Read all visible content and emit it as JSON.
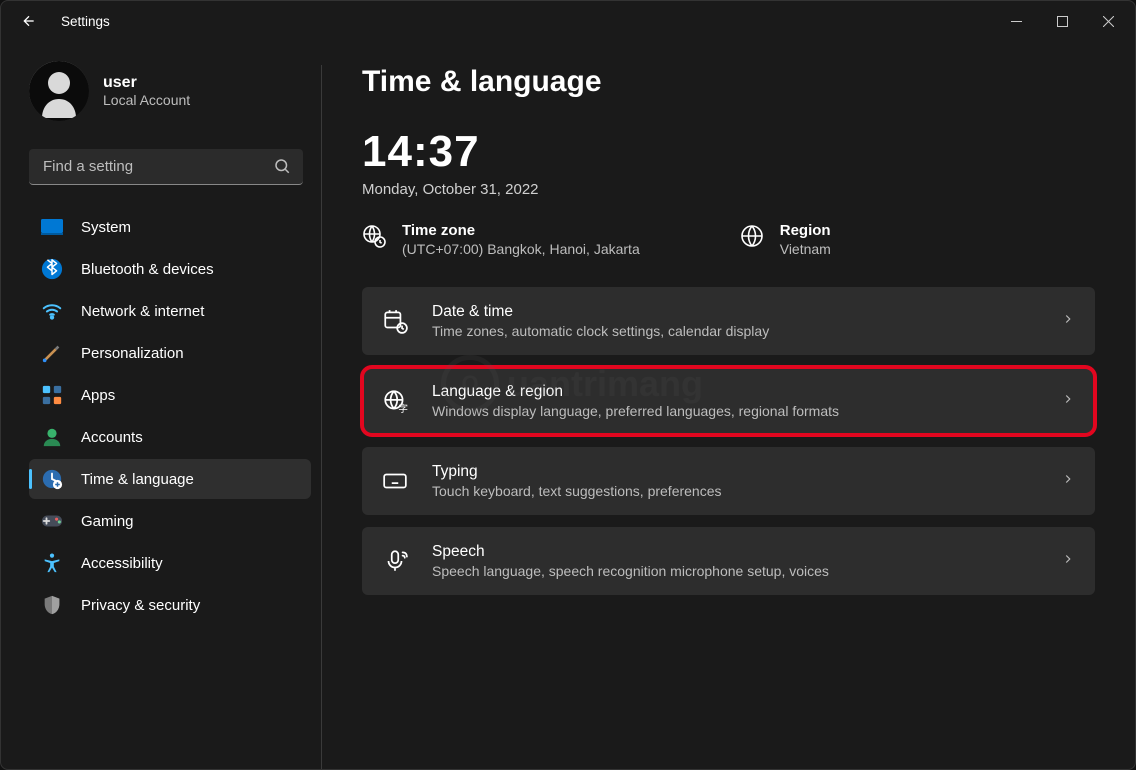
{
  "window": {
    "title": "Settings"
  },
  "user": {
    "name": "user",
    "subtitle": "Local Account"
  },
  "search": {
    "placeholder": "Find a setting"
  },
  "nav": {
    "items": [
      {
        "icon": "system",
        "label": "System"
      },
      {
        "icon": "bluetooth",
        "label": "Bluetooth & devices"
      },
      {
        "icon": "wifi",
        "label": "Network & internet"
      },
      {
        "icon": "personalize",
        "label": "Personalization"
      },
      {
        "icon": "apps",
        "label": "Apps"
      },
      {
        "icon": "accounts",
        "label": "Accounts"
      },
      {
        "icon": "timelang",
        "label": "Time & language"
      },
      {
        "icon": "gaming",
        "label": "Gaming"
      },
      {
        "icon": "accessibility",
        "label": "Accessibility"
      },
      {
        "icon": "privacy",
        "label": "Privacy & security"
      }
    ],
    "active_index": 6
  },
  "page": {
    "title": "Time & language",
    "time": "14:37",
    "date": "Monday, October 31, 2022",
    "info": [
      {
        "title": "Time zone",
        "subtitle": "(UTC+07:00) Bangkok, Hanoi, Jakarta"
      },
      {
        "title": "Region",
        "subtitle": "Vietnam"
      }
    ],
    "cards": [
      {
        "icon": "datetime",
        "title": "Date & time",
        "subtitle": "Time zones, automatic clock settings, calendar display",
        "highlight": false
      },
      {
        "icon": "langreg",
        "title": "Language & region",
        "subtitle": "Windows display language, preferred languages, regional formats",
        "highlight": true
      },
      {
        "icon": "typing",
        "title": "Typing",
        "subtitle": "Touch keyboard, text suggestions, preferences",
        "highlight": false
      },
      {
        "icon": "speech",
        "title": "Speech",
        "subtitle": "Speech language, speech recognition microphone setup, voices",
        "highlight": false
      }
    ]
  },
  "watermark": {
    "symbol": "Q",
    "text": "uantrimang"
  }
}
